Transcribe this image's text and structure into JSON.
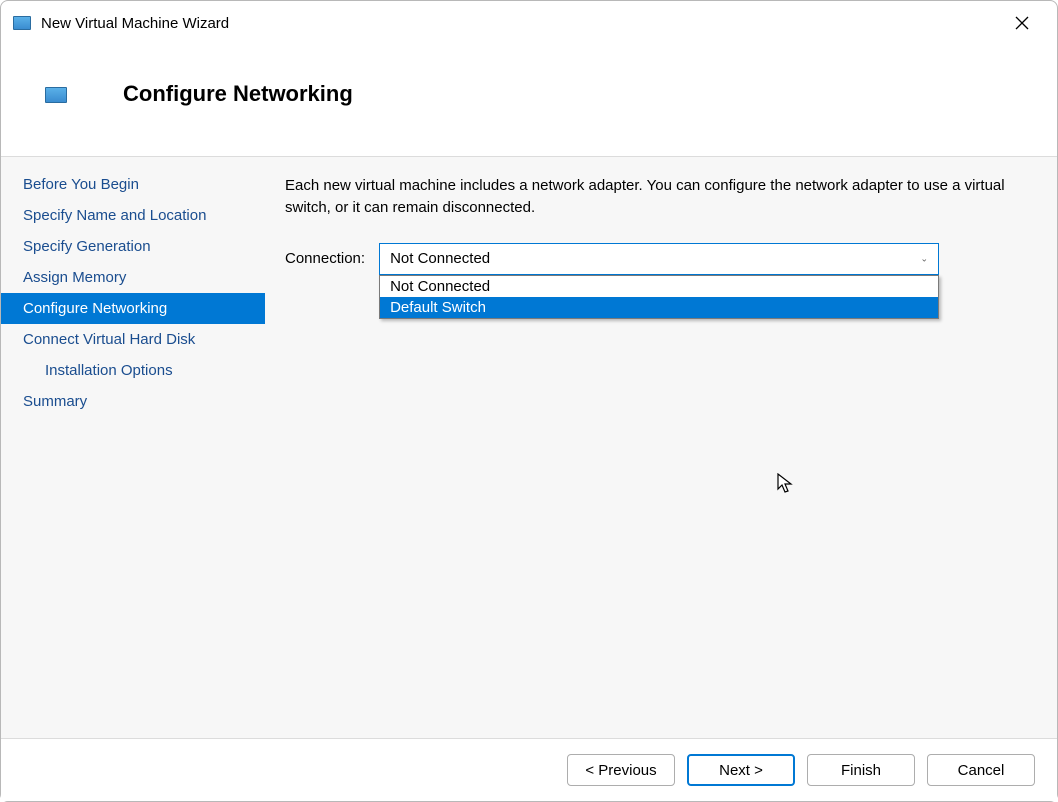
{
  "window": {
    "title": "New Virtual Machine Wizard"
  },
  "header": {
    "title": "Configure Networking"
  },
  "sidebar": {
    "items": [
      {
        "label": "Before You Begin",
        "active": false
      },
      {
        "label": "Specify Name and Location",
        "active": false
      },
      {
        "label": "Specify Generation",
        "active": false
      },
      {
        "label": "Assign Memory",
        "active": false
      },
      {
        "label": "Configure Networking",
        "active": true
      },
      {
        "label": "Connect Virtual Hard Disk",
        "active": false
      },
      {
        "label": "Installation Options",
        "active": false,
        "indent": true
      },
      {
        "label": "Summary",
        "active": false
      }
    ]
  },
  "content": {
    "description": "Each new virtual machine includes a network adapter. You can configure the network adapter to use a virtual switch, or it can remain disconnected.",
    "connection_label": "Connection:",
    "connection_value": "Not Connected",
    "dropdown_options": [
      {
        "label": "Not Connected",
        "highlight": false
      },
      {
        "label": "Default Switch",
        "highlight": true
      }
    ]
  },
  "footer": {
    "previous": "< Previous",
    "next": "Next >",
    "finish": "Finish",
    "cancel": "Cancel"
  }
}
